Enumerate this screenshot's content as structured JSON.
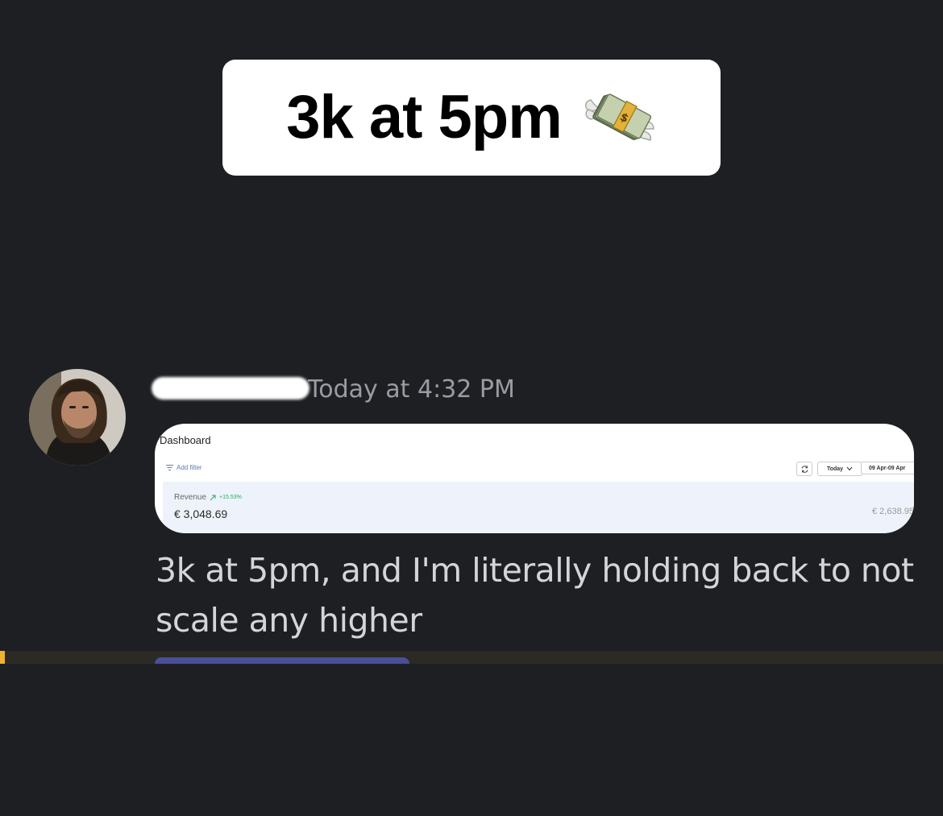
{
  "caption": {
    "text": "3k at 5pm",
    "icon": "money-with-wings-icon"
  },
  "message": {
    "avatar": "avatar",
    "timestamp": "Today at 4:32 PM",
    "text": "3k at 5pm, and I'm literally holding back to not scale any higher"
  },
  "dashboard": {
    "title": "Dashboard",
    "add_filter": "Add filter",
    "range": "Today",
    "date_range": "09 Apr-09 Apr",
    "revenue_label": "Revenue",
    "revenue_change": "+15.53%",
    "revenue_value": "€ 3,048.69",
    "revenue_compare": "€ 2,638.95"
  },
  "colors": {
    "background": "#1e1f23",
    "change_positive": "#2eab52",
    "divider_marker": "#f0b232"
  }
}
